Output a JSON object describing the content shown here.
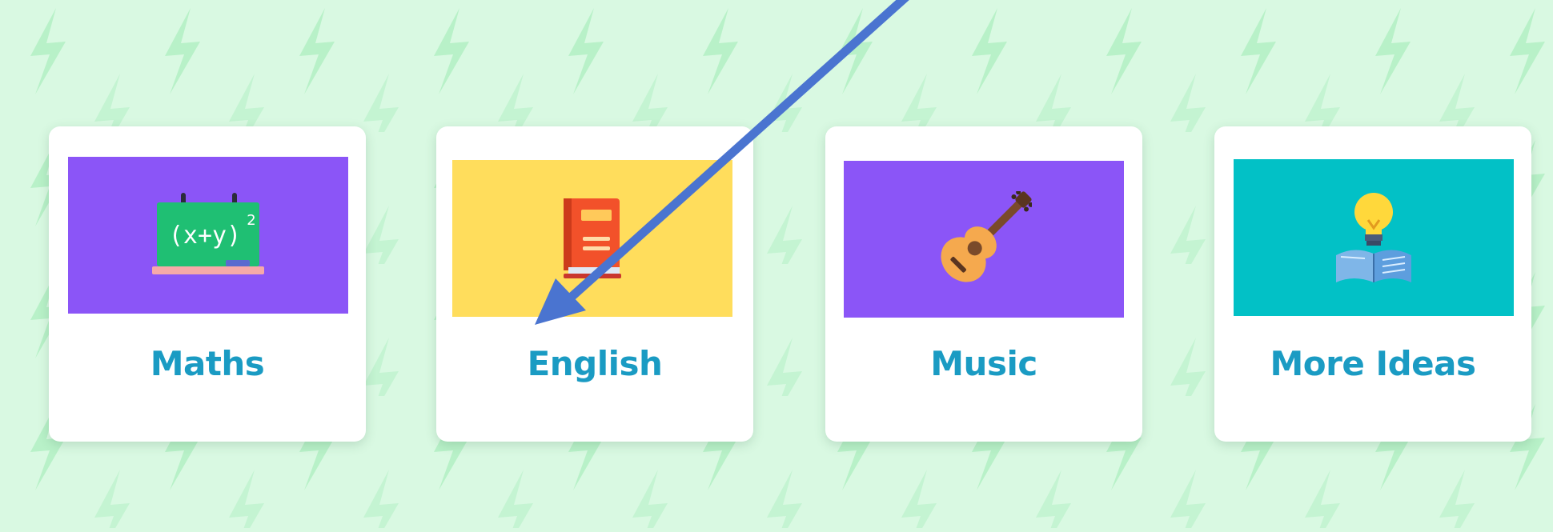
{
  "theme": {
    "background": "#d9f9e2",
    "pattern_color": "#b6f0c6",
    "card_background": "#ffffff",
    "label_color": "#1a9bc3",
    "arrow_color": "#4a74d0"
  },
  "cards": [
    {
      "label": "Maths",
      "image_bg": "#8b55f7",
      "icon": "chalkboard-formula-icon",
      "formula": "(x+y)",
      "exponent": "2"
    },
    {
      "label": "English",
      "image_bg": "#ffdd5c",
      "icon": "book-icon"
    },
    {
      "label": "Music",
      "image_bg": "#8b55f7",
      "icon": "guitar-icon"
    },
    {
      "label": "More Ideas",
      "image_bg": "#02c1c6",
      "icon": "lightbulb-book-icon"
    }
  ]
}
